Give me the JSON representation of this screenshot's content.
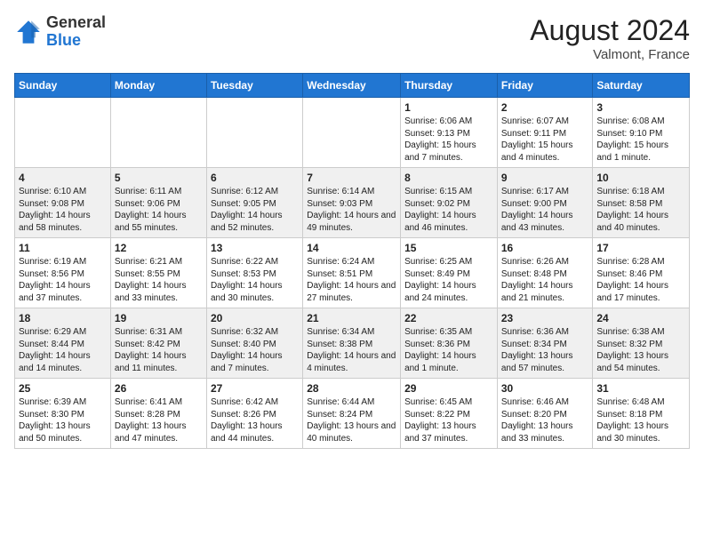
{
  "header": {
    "logo_general": "General",
    "logo_blue": "Blue",
    "month_year": "August 2024",
    "location": "Valmont, France"
  },
  "days_of_week": [
    "Sunday",
    "Monday",
    "Tuesday",
    "Wednesday",
    "Thursday",
    "Friday",
    "Saturday"
  ],
  "weeks": [
    [
      {
        "day": "",
        "info": ""
      },
      {
        "day": "",
        "info": ""
      },
      {
        "day": "",
        "info": ""
      },
      {
        "day": "",
        "info": ""
      },
      {
        "day": "1",
        "info": "Sunrise: 6:06 AM\nSunset: 9:13 PM\nDaylight: 15 hours and 7 minutes."
      },
      {
        "day": "2",
        "info": "Sunrise: 6:07 AM\nSunset: 9:11 PM\nDaylight: 15 hours and 4 minutes."
      },
      {
        "day": "3",
        "info": "Sunrise: 6:08 AM\nSunset: 9:10 PM\nDaylight: 15 hours and 1 minute."
      }
    ],
    [
      {
        "day": "4",
        "info": "Sunrise: 6:10 AM\nSunset: 9:08 PM\nDaylight: 14 hours and 58 minutes."
      },
      {
        "day": "5",
        "info": "Sunrise: 6:11 AM\nSunset: 9:06 PM\nDaylight: 14 hours and 55 minutes."
      },
      {
        "day": "6",
        "info": "Sunrise: 6:12 AM\nSunset: 9:05 PM\nDaylight: 14 hours and 52 minutes."
      },
      {
        "day": "7",
        "info": "Sunrise: 6:14 AM\nSunset: 9:03 PM\nDaylight: 14 hours and 49 minutes."
      },
      {
        "day": "8",
        "info": "Sunrise: 6:15 AM\nSunset: 9:02 PM\nDaylight: 14 hours and 46 minutes."
      },
      {
        "day": "9",
        "info": "Sunrise: 6:17 AM\nSunset: 9:00 PM\nDaylight: 14 hours and 43 minutes."
      },
      {
        "day": "10",
        "info": "Sunrise: 6:18 AM\nSunset: 8:58 PM\nDaylight: 14 hours and 40 minutes."
      }
    ],
    [
      {
        "day": "11",
        "info": "Sunrise: 6:19 AM\nSunset: 8:56 PM\nDaylight: 14 hours and 37 minutes."
      },
      {
        "day": "12",
        "info": "Sunrise: 6:21 AM\nSunset: 8:55 PM\nDaylight: 14 hours and 33 minutes."
      },
      {
        "day": "13",
        "info": "Sunrise: 6:22 AM\nSunset: 8:53 PM\nDaylight: 14 hours and 30 minutes."
      },
      {
        "day": "14",
        "info": "Sunrise: 6:24 AM\nSunset: 8:51 PM\nDaylight: 14 hours and 27 minutes."
      },
      {
        "day": "15",
        "info": "Sunrise: 6:25 AM\nSunset: 8:49 PM\nDaylight: 14 hours and 24 minutes."
      },
      {
        "day": "16",
        "info": "Sunrise: 6:26 AM\nSunset: 8:48 PM\nDaylight: 14 hours and 21 minutes."
      },
      {
        "day": "17",
        "info": "Sunrise: 6:28 AM\nSunset: 8:46 PM\nDaylight: 14 hours and 17 minutes."
      }
    ],
    [
      {
        "day": "18",
        "info": "Sunrise: 6:29 AM\nSunset: 8:44 PM\nDaylight: 14 hours and 14 minutes."
      },
      {
        "day": "19",
        "info": "Sunrise: 6:31 AM\nSunset: 8:42 PM\nDaylight: 14 hours and 11 minutes."
      },
      {
        "day": "20",
        "info": "Sunrise: 6:32 AM\nSunset: 8:40 PM\nDaylight: 14 hours and 7 minutes."
      },
      {
        "day": "21",
        "info": "Sunrise: 6:34 AM\nSunset: 8:38 PM\nDaylight: 14 hours and 4 minutes."
      },
      {
        "day": "22",
        "info": "Sunrise: 6:35 AM\nSunset: 8:36 PM\nDaylight: 14 hours and 1 minute."
      },
      {
        "day": "23",
        "info": "Sunrise: 6:36 AM\nSunset: 8:34 PM\nDaylight: 13 hours and 57 minutes."
      },
      {
        "day": "24",
        "info": "Sunrise: 6:38 AM\nSunset: 8:32 PM\nDaylight: 13 hours and 54 minutes."
      }
    ],
    [
      {
        "day": "25",
        "info": "Sunrise: 6:39 AM\nSunset: 8:30 PM\nDaylight: 13 hours and 50 minutes."
      },
      {
        "day": "26",
        "info": "Sunrise: 6:41 AM\nSunset: 8:28 PM\nDaylight: 13 hours and 47 minutes."
      },
      {
        "day": "27",
        "info": "Sunrise: 6:42 AM\nSunset: 8:26 PM\nDaylight: 13 hours and 44 minutes."
      },
      {
        "day": "28",
        "info": "Sunrise: 6:44 AM\nSunset: 8:24 PM\nDaylight: 13 hours and 40 minutes."
      },
      {
        "day": "29",
        "info": "Sunrise: 6:45 AM\nSunset: 8:22 PM\nDaylight: 13 hours and 37 minutes."
      },
      {
        "day": "30",
        "info": "Sunrise: 6:46 AM\nSunset: 8:20 PM\nDaylight: 13 hours and 33 minutes."
      },
      {
        "day": "31",
        "info": "Sunrise: 6:48 AM\nSunset: 8:18 PM\nDaylight: 13 hours and 30 minutes."
      }
    ]
  ]
}
